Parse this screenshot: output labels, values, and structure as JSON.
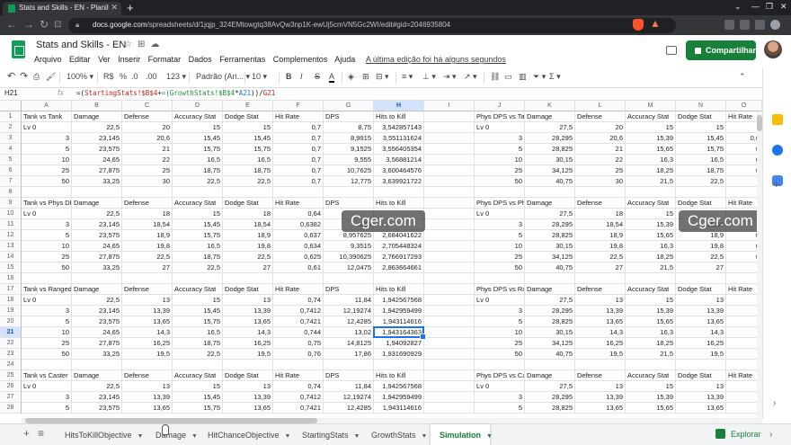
{
  "browser": {
    "tab_title": "Stats and Skills - EN - Planilhas Go",
    "url_host": "docs.google.com",
    "url_path": "/spreadsheets/d/1jqjp_324EMtowgtq38AvQw3np1K-ewUj5cmVN5Gc2WI/edit#gid=2046935804"
  },
  "doc": {
    "title": "Stats and Skills - EN",
    "menus": [
      "Arquivo",
      "Editar",
      "Ver",
      "Inserir",
      "Formatar",
      "Dados",
      "Ferramentas",
      "Complementos",
      "Ajuda"
    ],
    "last_edit": "A última edição foi há alguns segundos",
    "share_label": "Compartilhar"
  },
  "toolbar": {
    "zoom": "100%",
    "currency": "R$",
    "percent": "%",
    "dec_less": ".0",
    "dec_more": ".00",
    "format_more": "123",
    "font": "Padrão (Ari...",
    "font_size": "10",
    "bold": "B",
    "italic": "I",
    "strike": "S",
    "text_color": "A",
    "functions": "Σ"
  },
  "formula_bar": {
    "cell_ref": "H21",
    "fx": "fx",
    "eq": "=(",
    "ref1": "StartingStats!$B$4",
    "plus": "+",
    "ref2": "GrowthStats!$B$4",
    "times": "*",
    "ref3": "A21",
    "tail": "))/",
    "ref4": "G21"
  },
  "grid": {
    "columns": [
      "A",
      "B",
      "C",
      "D",
      "E",
      "F",
      "G",
      "H",
      "I",
      "J",
      "K",
      "L",
      "M",
      "N",
      "O"
    ],
    "selected_col": "H",
    "selected_row": "21",
    "rows": [
      {
        "n": "1",
        "cells": [
          "Tank vs Tank",
          "Damage",
          "Defense",
          "Accuracy Stat",
          "Dodge Stat",
          "Hit Rate",
          "DPS",
          "Hits to Kill",
          "",
          "Phys DPS vs Tank",
          "Damage",
          "Defense",
          "Accuracy Stat",
          "Dodge Stat",
          "Hit Rate"
        ]
      },
      {
        "n": "2",
        "cells": [
          "Lv 0",
          "22,5",
          "20",
          "15",
          "15",
          "0,7",
          "8,75",
          "3,542857143",
          "",
          "Lv 0",
          "27,5",
          "20",
          "15",
          "15",
          ""
        ]
      },
      {
        "n": "3",
        "cells": [
          "3",
          "23,145",
          "20,6",
          "15,45",
          "15,45",
          "0,7",
          "8,9915",
          "3,551131624",
          "",
          "3",
          "28,295",
          "20,6",
          "15,39",
          "15,45",
          "0,6"
        ]
      },
      {
        "n": "4",
        "cells": [
          "5",
          "23,575",
          "21",
          "15,75",
          "15,75",
          "0,7",
          "9,1525",
          "3,556405354",
          "",
          "5",
          "28,825",
          "21",
          "15,65",
          "15,75",
          "0"
        ]
      },
      {
        "n": "5",
        "cells": [
          "10",
          "24,65",
          "22",
          "16,5",
          "16,5",
          "0,7",
          "9,555",
          "3,56881214",
          "",
          "10",
          "30,15",
          "22",
          "16,3",
          "16,5",
          "0"
        ]
      },
      {
        "n": "6",
        "cells": [
          "25",
          "27,875",
          "25",
          "18,75",
          "18,75",
          "0,7",
          "10,7625",
          "3,600464576",
          "",
          "25",
          "34,125",
          "25",
          "18,25",
          "18,75",
          "0"
        ]
      },
      {
        "n": "7",
        "cells": [
          "50",
          "33,25",
          "30",
          "22,5",
          "22,5",
          "0,7",
          "12,775",
          "3,639921722",
          "",
          "50",
          "40,75",
          "30",
          "21,5",
          "22,5",
          ""
        ]
      },
      {
        "n": "8",
        "cells": [
          "",
          "",
          "",
          "",
          "",
          "",
          "",
          "",
          "",
          "",
          "",
          "",
          "",
          "",
          ""
        ]
      },
      {
        "n": "9",
        "cells": [
          "Tank vs Phys DPS",
          "Damage",
          "Defense",
          "Accuracy Stat",
          "Dodge Stat",
          "Hit Rate",
          "DPS",
          "Hits to Kill",
          "",
          "Phys DPS vs Phys DPS",
          "Damage",
          "Defense",
          "Accuracy Stat",
          "Dodge Stat",
          "Hit Rate"
        ]
      },
      {
        "n": "10",
        "cells": [
          "Lv 0",
          "22,5",
          "18",
          "15",
          "18",
          "0,64",
          "",
          "",
          "",
          "Lv 0",
          "27,5",
          "18",
          "15",
          "",
          ""
        ]
      },
      {
        "n": "11",
        "cells": [
          "3",
          "23,145",
          "18,54",
          "15,45",
          "18,54",
          "0,6382",
          "8,85",
          "",
          "",
          "3",
          "28,295",
          "18,54",
          "15,39",
          "18,54",
          ""
        ]
      },
      {
        "n": "12",
        "cells": [
          "5",
          "23,575",
          "18,9",
          "15,75",
          "18,9",
          "0,637",
          "8,957625",
          "2,684041622",
          "",
          "5",
          "28,825",
          "18,9",
          "15,65",
          "18,9",
          "0"
        ]
      },
      {
        "n": "13",
        "cells": [
          "10",
          "24,65",
          "19,8",
          "16,5",
          "19,8",
          "0,634",
          "9,3515",
          "2,705448324",
          "",
          "10",
          "30,15",
          "19,8",
          "16,3",
          "19,8",
          "0"
        ]
      },
      {
        "n": "14",
        "cells": [
          "25",
          "27,875",
          "22,5",
          "18,75",
          "22,5",
          "0,625",
          "10,390625",
          "2,766917293",
          "",
          "25",
          "34,125",
          "22,5",
          "18,25",
          "22,5",
          "0"
        ]
      },
      {
        "n": "15",
        "cells": [
          "50",
          "33,25",
          "27",
          "22,5",
          "27",
          "0,61",
          "12,0475",
          "2,863664661",
          "",
          "50",
          "40,75",
          "27",
          "21,5",
          "27",
          ""
        ]
      },
      {
        "n": "16",
        "cells": [
          "",
          "",
          "",
          "",
          "",
          "",
          "",
          "",
          "",
          "",
          "",
          "",
          "",
          "",
          ""
        ]
      },
      {
        "n": "17",
        "cells": [
          "Tank vs Ranged DPS",
          "Damage",
          "Defense",
          "Accuracy Stat",
          "Dodge Stat",
          "Hit Rate",
          "DPS",
          "Hits to Kill",
          "",
          "Phys DPS vs Ranged DPS",
          "Damage",
          "Defense",
          "Accuracy Stat",
          "Dodge Stat",
          "Hit Rate"
        ]
      },
      {
        "n": "18",
        "cells": [
          "Lv 0",
          "22,5",
          "13",
          "15",
          "13",
          "0,74",
          "11,84",
          "1,942567568",
          "",
          "Lv 0",
          "27,5",
          "13",
          "15",
          "13",
          ""
        ]
      },
      {
        "n": "19",
        "cells": [
          "3",
          "23,145",
          "13,39",
          "15,45",
          "13,39",
          "0,7412",
          "12,19274",
          "1,942959499",
          "",
          "3",
          "28,295",
          "13,39",
          "15,39",
          "13,39",
          ""
        ]
      },
      {
        "n": "20",
        "cells": [
          "5",
          "23,575",
          "13,65",
          "15,75",
          "13,65",
          "0,7421",
          "12,4285",
          "1,943114616",
          "",
          "5",
          "28,825",
          "13,65",
          "15,65",
          "13,65",
          ""
        ]
      },
      {
        "n": "21",
        "cells": [
          "10",
          "24,65",
          "14,3",
          "16,5",
          "14,3",
          "0,744",
          "13,02",
          "1,943164363",
          "",
          "10",
          "30,15",
          "14,3",
          "16,3",
          "14,3",
          ""
        ]
      },
      {
        "n": "22",
        "cells": [
          "25",
          "27,875",
          "16,25",
          "18,75",
          "16,25",
          "0,75",
          "14,8125",
          "1,94092827",
          "",
          "25",
          "34,125",
          "16,25",
          "18,25",
          "16,25",
          ""
        ]
      },
      {
        "n": "23",
        "cells": [
          "50",
          "33,25",
          "19,5",
          "22,5",
          "19,5",
          "0,76",
          "17,86",
          "1,931690929",
          "",
          "50",
          "40,75",
          "19,5",
          "21,5",
          "19,5",
          ""
        ]
      },
      {
        "n": "24",
        "cells": [
          "",
          "",
          "",
          "",
          "",
          "",
          "",
          "",
          "",
          "",
          "",
          "",
          "",
          "",
          ""
        ]
      },
      {
        "n": "25",
        "cells": [
          "Tank vs Caster",
          "Damage",
          "Defense",
          "Accuracy Stat",
          "Dodge Stat",
          "Hit Rate",
          "DPS",
          "Hits to Kill",
          "",
          "Phys DPS vs Caster",
          "Damage",
          "Defense",
          "Accuracy Stat",
          "Dodge Stat",
          "Hit Rate"
        ]
      },
      {
        "n": "26",
        "cells": [
          "Lv 0",
          "22,5",
          "13",
          "15",
          "13",
          "0,74",
          "11,84",
          "1,942567568",
          "",
          "Lv 0",
          "27,5",
          "13",
          "15",
          "13",
          ""
        ]
      },
      {
        "n": "27",
        "cells": [
          "3",
          "23,145",
          "13,39",
          "15,45",
          "13,39",
          "0,7412",
          "12,19274",
          "1,942959499",
          "",
          "3",
          "28,295",
          "13,39",
          "15,39",
          "13,39",
          ""
        ]
      },
      {
        "n": "28",
        "cells": [
          "5",
          "23,575",
          "13,65",
          "15,75",
          "13,65",
          "0,7421",
          "12,4285",
          "1,943114616",
          "",
          "5",
          "28,825",
          "13,65",
          "15,65",
          "13,65",
          ""
        ]
      }
    ]
  },
  "watermark": "Cger.com",
  "sheets": {
    "tabs": [
      "HitsToKillObjective",
      "Damage",
      "HitChanceObjective",
      "StartingStats",
      "GrowthStats",
      "Simulation"
    ],
    "active": "Simulation",
    "explore": "Explorar"
  },
  "colors": {
    "brand_green": "#188038",
    "selection_blue": "#1a73e8"
  }
}
